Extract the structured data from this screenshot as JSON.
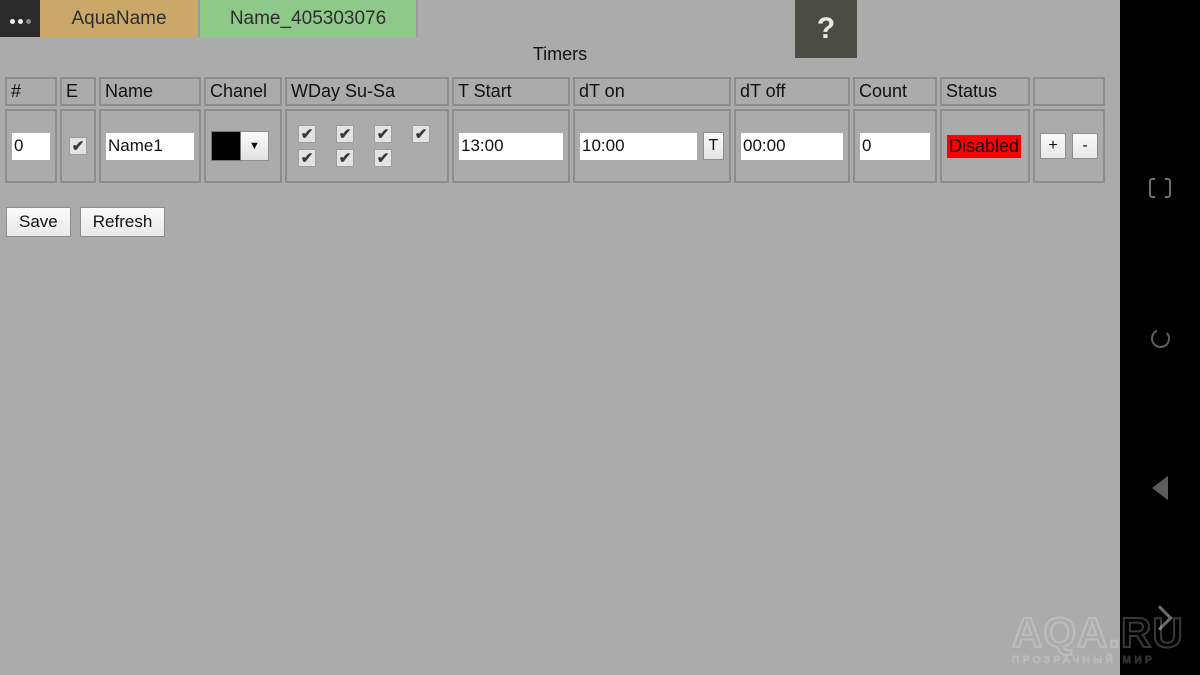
{
  "browser": {
    "menu_icon": "kebab-menu-icon",
    "tabs": [
      {
        "label": "AquaName",
        "color": "#c9a86a",
        "active": false
      },
      {
        "label": "Name_405303076",
        "color": "#8fc98a",
        "active": true
      }
    ]
  },
  "help": {
    "label": "?",
    "icon": "question-mark-icon"
  },
  "page": {
    "title": "Timers"
  },
  "table": {
    "headers": [
      "#",
      "E",
      "Name",
      "Chanel",
      "WDay Su-Sa",
      "T Start",
      "dT on",
      "dT off",
      "Count",
      "Status",
      ""
    ],
    "rows": [
      {
        "num": "0",
        "enabled": true,
        "name": "Name1",
        "chanel_color": "#000000",
        "chanel_dropdown_icon": "chevron-down-icon",
        "wday": [
          true,
          true,
          true,
          true,
          true,
          true,
          true
        ],
        "t_start": "13:00",
        "dt_on": "10:00",
        "dt_on_button": "T",
        "dt_off": "00:00",
        "count": "0",
        "status": "Disabled",
        "status_color": "#ff0000",
        "add_label": "+",
        "remove_label": "-"
      }
    ]
  },
  "footer": {
    "save_label": "Save",
    "refresh_label": "Refresh"
  },
  "navbar": {
    "items": [
      {
        "icon": "fullscreen-icon"
      },
      {
        "icon": "rotate-icon"
      },
      {
        "icon": "back-icon"
      },
      {
        "icon": "forward-icon"
      }
    ]
  },
  "watermark": {
    "main": "AQA.RU",
    "sub": "ПРОЗРАЧНЫЙ МИР"
  }
}
